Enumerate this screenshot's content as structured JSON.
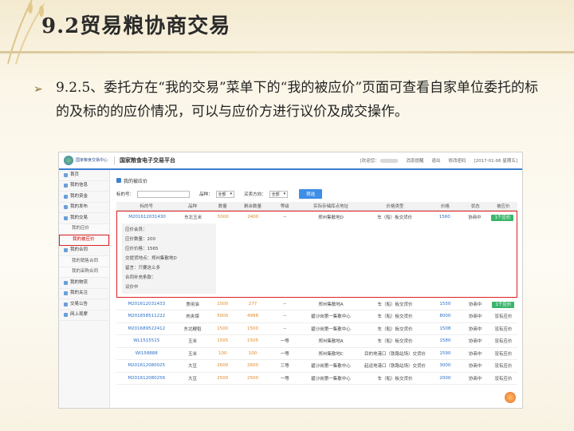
{
  "slide": {
    "title": "9.2贸易粮协商交易",
    "bullet": "➢",
    "paragraph": "9.2.5、委托方在“我的交易”菜单下的“我的被应价”页面可查看自家单位委托的标的及标的的应价情况，可以与应价方进行议价及成交操作。"
  },
  "app": {
    "logo_text": "国家粮食交易中心",
    "system_name": "国家粮食电子交易平台",
    "welcome": "[欢迎您：",
    "messages": "消息提醒",
    "logout": "退出",
    "change_password": "修改密码",
    "date": "[2017-01-06 星期五]"
  },
  "sidebar": {
    "items": [
      {
        "label": "首页"
      },
      {
        "label": "我的信息"
      },
      {
        "label": "我的资金"
      },
      {
        "label": "我的发布"
      },
      {
        "label": "我的交易"
      },
      {
        "label": "我的应价"
      },
      {
        "label": "我的被应价"
      },
      {
        "label": "我的合同"
      },
      {
        "label": "我的销售合同"
      },
      {
        "label": "我的采购合同"
      },
      {
        "label": "我的物流"
      },
      {
        "label": "我的关注"
      },
      {
        "label": "交易公告"
      },
      {
        "label": "网上观摩"
      }
    ]
  },
  "main": {
    "breadcrumb": "我的被应价",
    "filters": {
      "code_label": "标的号：",
      "variety_label": "品种：",
      "variety_value": "全部",
      "direction_label": "买卖方向：",
      "direction_value": "全部",
      "search_button": "筛选"
    },
    "columns": [
      "标的号",
      "品种",
      "数量",
      "剩余数量",
      "等级",
      "实际存储库点地址",
      "价格类型",
      "价格",
      "状态",
      "被应价"
    ],
    "highlight_row": {
      "code": "M201612031430",
      "variety": "东北玉米",
      "qty": "5000",
      "remain": "2400",
      "grade": "--",
      "address": "郑州集散地D",
      "price_type": "车（船）板交货价",
      "price": "1560",
      "status": "协商中",
      "action": "1个应价"
    },
    "details": [
      "应价会员：",
      "应价数量：200",
      "应价价格：1565",
      "交提货地点：郑州集散地D",
      "留言：只要这么多",
      "合同补充条款：",
      "议价中"
    ],
    "rows": [
      {
        "code": "M201612031433",
        "variety": "食用油",
        "qty": "1500",
        "remain": "277",
        "grade": "--",
        "address": "郑州集散地A",
        "price_type": "车（船）板交货价",
        "price": "1550",
        "status": "协商中",
        "action": "1个应价"
      },
      {
        "code": "M201658511222",
        "variety": "肉夹馍",
        "qty": "5000",
        "remain": "4988",
        "grade": "--",
        "address": "碧沙岗第一集散中心",
        "price_type": "车（船）板交货价",
        "price": "8000",
        "status": "协商中",
        "action": "没有应价"
      },
      {
        "code": "M201689522412",
        "variety": "东北粳稻",
        "qty": "1500",
        "remain": "1500",
        "grade": "--",
        "address": "碧沙岗第一集散中心",
        "price_type": "车（船）板交货价",
        "price": "1508",
        "status": "协商中",
        "action": "没有应价"
      },
      {
        "code": "WL1515515",
        "variety": "玉米",
        "qty": "1505",
        "remain": "1505",
        "grade": "一等",
        "address": "郑州集散地A",
        "price_type": "车（船）板交货价",
        "price": "1580",
        "status": "协商中",
        "action": "没有应价"
      },
      {
        "code": "WI158888",
        "variety": "玉米",
        "qty": "100",
        "remain": "100",
        "grade": "一等",
        "address": "郑州集散地C",
        "price_type": "目的地港口（铁路站场）交货价",
        "price": "1590",
        "status": "协商中",
        "action": "没有应价"
      },
      {
        "code": "M201612080025",
        "variety": "大豆",
        "qty": "2600",
        "remain": "2600",
        "grade": "三等",
        "address": "碧沙岗第一集散中心",
        "price_type": "起运地港口（铁路站场）交货价",
        "price": "3000",
        "status": "协商中",
        "action": "没有应价"
      },
      {
        "code": "M201612080025b",
        "variety": "大豆",
        "qty": "2500",
        "remain": "2500",
        "grade": "一等",
        "address": "碧沙岗第一集散中心",
        "price_type": "车（船）板交货价",
        "price": "2000",
        "status": "协商中",
        "action": "没有应价"
      }
    ]
  }
}
